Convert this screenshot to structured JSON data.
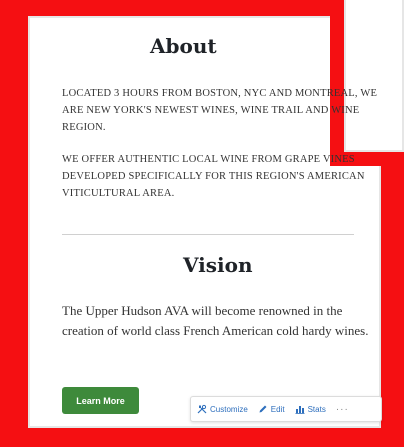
{
  "about": {
    "title": "About",
    "paragraph1": "LOCATED 3 HOURS FROM BOSTON, NYC AND MONTREAL, WE ARE NEW YORK'S NEWEST WINES, WINE TRAIL AND WINE REGION.",
    "paragraph2": "WE OFFER AUTHENTIC LOCAL WINE FROM GRAPE VINES DEVELOPED SPECIFICALLY FOR THIS REGION'S AMERICAN VITICULTURAL AREA."
  },
  "vision": {
    "title": "Vision",
    "text": "The Upper Hudson AVA will become renowned in the creation of world class French American cold hardy wines."
  },
  "button": {
    "learn_more": "Learn More"
  },
  "toolbar": {
    "customize": "Customize",
    "edit": "Edit",
    "stats": "Stats",
    "more": "···"
  },
  "colors": {
    "frame_red": "#f50f12",
    "button_green": "#3e8a3b",
    "link_blue": "#2e6fbd"
  },
  "icons": {
    "customize": "wrench-screwdriver-icon",
    "edit": "pencil-icon",
    "stats": "bar-chart-icon",
    "more": "ellipsis-icon"
  }
}
